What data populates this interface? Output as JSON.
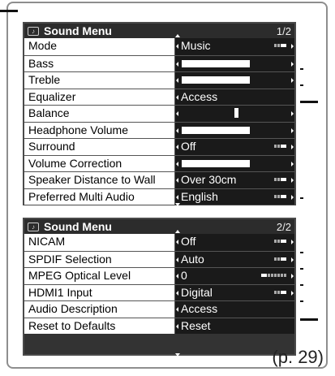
{
  "panel1": {
    "title": "Sound Menu",
    "page": "1/2",
    "rows": [
      {
        "label": "Mode",
        "value": "Music"
      },
      {
        "label": "Bass",
        "level": 0.56
      },
      {
        "label": "Treble",
        "level": 0.56
      },
      {
        "label": "Equalizer",
        "value": "Access"
      },
      {
        "label": "Balance",
        "balance": 0.5
      },
      {
        "label": "Headphone Volume",
        "level": 0.56
      },
      {
        "label": "Surround",
        "value": "Off"
      },
      {
        "label": "Volume Correction",
        "level": 0.56
      },
      {
        "label": "Speaker Distance to Wall",
        "value": "Over 30cm"
      },
      {
        "label": "Preferred Multi Audio",
        "value": "English"
      }
    ]
  },
  "panel2": {
    "title": "Sound Menu",
    "page": "2/2",
    "rows": [
      {
        "label": "NICAM",
        "value": "Off"
      },
      {
        "label": "SPDIF Selection",
        "value": "Auto"
      },
      {
        "label": "MPEG Optical Level",
        "value": "0"
      },
      {
        "label": "HDMI1 Input",
        "value": "Digital"
      },
      {
        "label": "Audio Description",
        "value": "Access"
      },
      {
        "label": "Reset to Defaults",
        "value": "Reset"
      }
    ]
  },
  "page_reference": "(p. 29)"
}
